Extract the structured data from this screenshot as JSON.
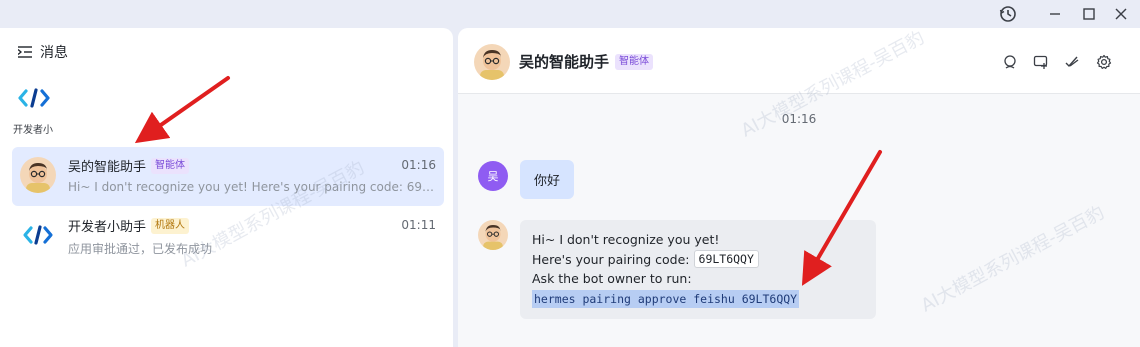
{
  "window": {
    "controls": [
      "history-icon",
      "minimize-icon",
      "maximize-icon",
      "close-icon"
    ]
  },
  "left": {
    "title": "消息",
    "app_name": "开发者小",
    "chats": [
      {
        "name": "吴的智能助手",
        "badge": "智能体",
        "time": "01:16",
        "preview": "Hi~ I don't recognize you yet! Here's your pairing code: 69LT6QQY..."
      },
      {
        "name": "开发者小助手",
        "badge": "机器人",
        "time": "01:11",
        "preview": "应用审批通过，已发布成功"
      }
    ]
  },
  "right": {
    "title": "吴的智能助手",
    "badge": "智能体",
    "timestamp": "01:16",
    "user_avatar": "吴",
    "user_message": "你好",
    "bot_message": {
      "line1": "Hi~ I don't recognize you yet!",
      "line2_prefix": "Here's your pairing code:",
      "pairing_code": "69LT6QQY",
      "line3": "Ask the bot owner to run:",
      "command": "hermes pairing approve feishu 69LT6QQY"
    }
  },
  "watermark": "AI大模型系列课程-吴百豹",
  "colors": {
    "accent_purple": "#8f5cf2",
    "active_row": "#e3ebff",
    "user_bubble": "#d6e4ff",
    "arrow_red": "#e01f1f"
  }
}
